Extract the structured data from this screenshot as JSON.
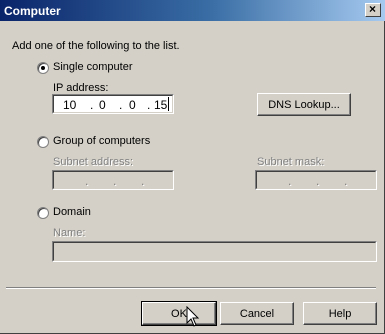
{
  "dialog": {
    "title": "Computer",
    "instruction": "Add one of the following to the list."
  },
  "options": {
    "single": {
      "label": "Single computer",
      "selected": true
    },
    "group": {
      "label": "Group of computers",
      "selected": false
    },
    "domain": {
      "label": "Domain",
      "selected": false
    }
  },
  "single": {
    "ip_label": "IP address:",
    "ip": [
      "10",
      "0",
      "0",
      "15"
    ],
    "dns_button": "DNS Lookup..."
  },
  "group": {
    "subnet_address_label": "Subnet address:",
    "subnet_mask_label": "Subnet mask:"
  },
  "domain": {
    "name_label": "Name:"
  },
  "buttons": {
    "ok": "OK",
    "cancel": "Cancel",
    "help": "Help"
  },
  "icons": {
    "close": "close-icon",
    "pointer": "mouse-pointer-icon"
  }
}
